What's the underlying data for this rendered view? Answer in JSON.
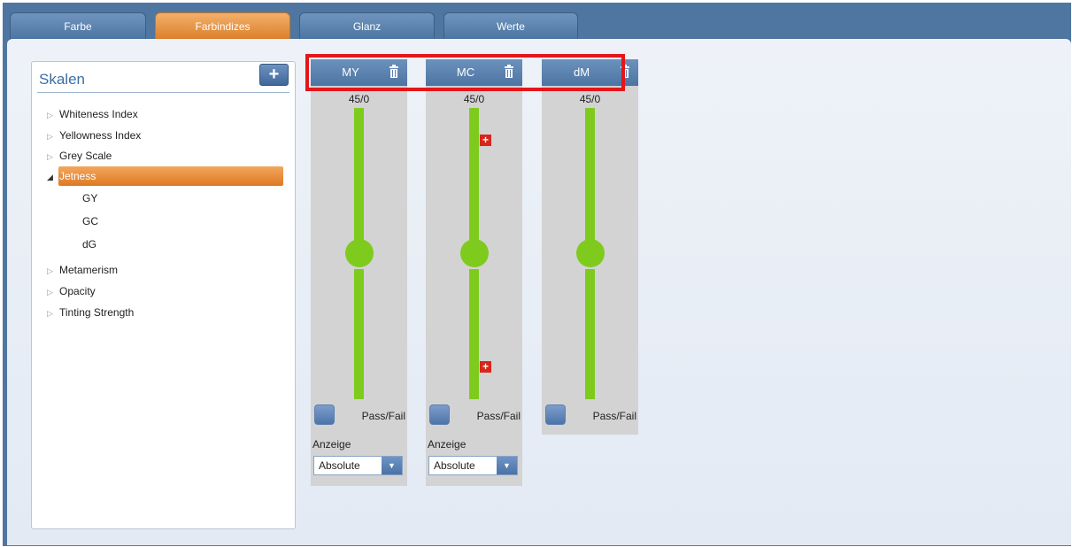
{
  "tabs": [
    {
      "label": "Farbe",
      "active": false
    },
    {
      "label": "Farbindizes",
      "active": true
    },
    {
      "label": "Glanz",
      "active": false
    },
    {
      "label": "Werte",
      "active": false
    }
  ],
  "scales": {
    "title": "Skalen",
    "add_label": "+",
    "items": [
      {
        "label": "Whiteness Index",
        "expanded": false
      },
      {
        "label": "Yellowness Index",
        "expanded": false
      },
      {
        "label": "Grey Scale",
        "expanded": false
      },
      {
        "label": "Jetness",
        "expanded": true,
        "selected": true,
        "children": [
          "GY",
          "GC",
          "dG"
        ]
      },
      {
        "label": "Metamerism",
        "expanded": false
      },
      {
        "label": "Opacity",
        "expanded": false
      },
      {
        "label": "Tinting Strength",
        "expanded": false
      }
    ]
  },
  "columns": [
    {
      "name": "MY",
      "geometry": "45/0",
      "pass_fail_label": "Pass/Fail",
      "anzeige_label": "Anzeige",
      "anzeige_value": "Absolute",
      "has_markers": false,
      "has_anzeige": true
    },
    {
      "name": "MC",
      "geometry": "45/0",
      "pass_fail_label": "Pass/Fail",
      "anzeige_label": "Anzeige",
      "anzeige_value": "Absolute",
      "has_markers": true,
      "has_anzeige": true
    },
    {
      "name": "dM",
      "geometry": "45/0",
      "pass_fail_label": "Pass/Fail",
      "has_markers": false,
      "has_anzeige": false
    }
  ],
  "icons": {
    "trash": "trash-icon",
    "plus": "plus-icon",
    "dropdown": "chevron-down-icon"
  },
  "colors": {
    "accent": "#dd7a24",
    "slider": "#7ecb1e",
    "highlight_box": "#e3161b",
    "marker": "#d9261c"
  }
}
